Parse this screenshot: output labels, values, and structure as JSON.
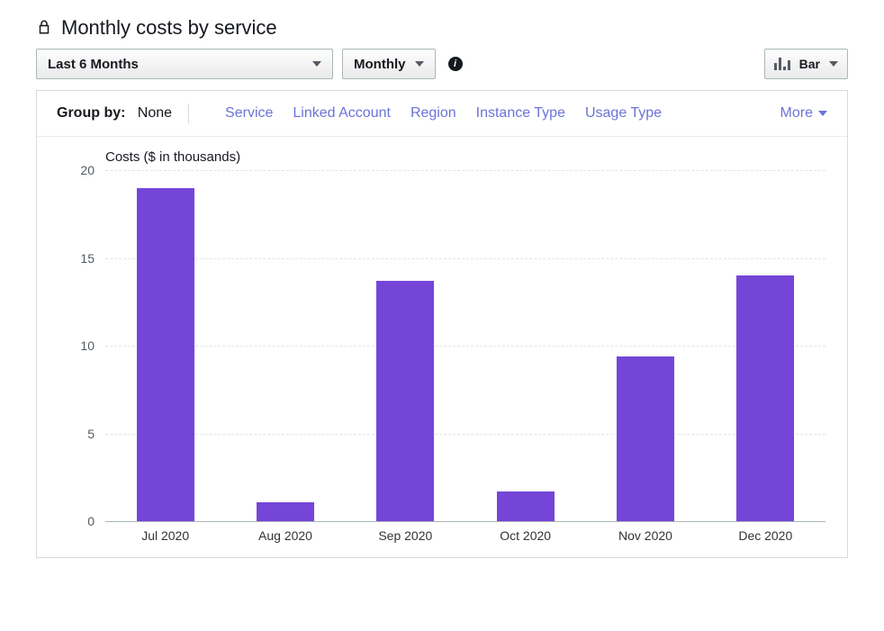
{
  "title": "Monthly costs by service",
  "controls": {
    "date_range": "Last 6 Months",
    "granularity": "Monthly",
    "chart_type": "Bar"
  },
  "group_by": {
    "label": "Group by:",
    "selected": "None",
    "options": [
      "Service",
      "Linked Account",
      "Region",
      "Instance Type",
      "Usage Type"
    ],
    "more_label": "More"
  },
  "chart_data": {
    "type": "bar",
    "title": "Costs ($ in thousands)",
    "xlabel": "",
    "ylabel": "Costs ($ in thousands)",
    "ylim": [
      0,
      20
    ],
    "yticks": [
      0,
      5,
      10,
      15,
      20
    ],
    "categories": [
      "Jul 2020",
      "Aug 2020",
      "Sep 2020",
      "Oct 2020",
      "Nov 2020",
      "Dec 2020"
    ],
    "values": [
      19.0,
      1.1,
      13.7,
      1.7,
      9.4,
      14.0
    ],
    "bar_color": "#7545d8"
  }
}
